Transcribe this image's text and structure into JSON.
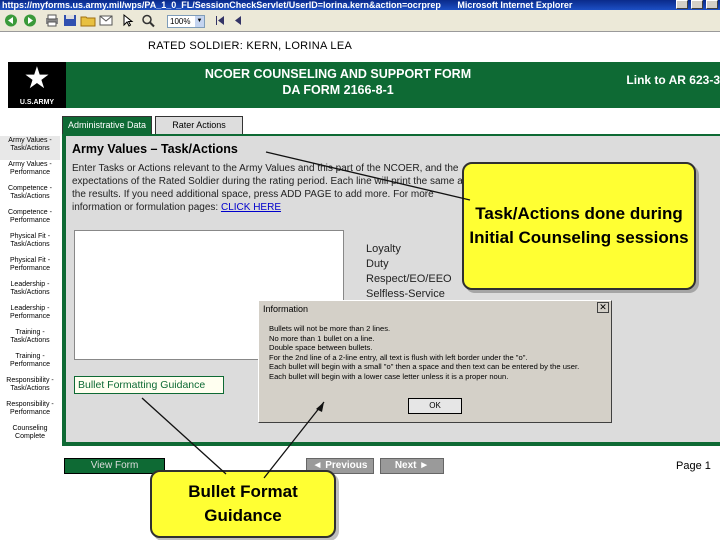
{
  "browser": {
    "url": "https://myforms.us.army.mil/wps/PA_1_0_FL/SessionCheckServlet/UserID=lorina.kern&action=ocrprep",
    "app_name": "Microsoft Internet Explorer",
    "zoom": "100%"
  },
  "rated_soldier": "RATED SOLDIER:  KERN, LORINA LEA",
  "header": {
    "logo_text": "U.S.ARMY",
    "form_title_line1": "NCOER COUNSELING AND SUPPORT FORM",
    "form_title_line2": "DA FORM 2166-8-1",
    "link_label": "Link to AR 623-3"
  },
  "tabs": [
    {
      "label": "Administrative Data"
    },
    {
      "label": "Rater Actions"
    }
  ],
  "sidebar": {
    "items": [
      {
        "line1": "Army Values -",
        "line2": "Task/Actions"
      },
      {
        "line1": "Army Values -",
        "line2": "Performance"
      },
      {
        "line1": "Competence -",
        "line2": "Task/Actions"
      },
      {
        "line1": "Competence -",
        "line2": "Performance"
      },
      {
        "line1": "Physical Fit -",
        "line2": "Task/Actions"
      },
      {
        "line1": "Physical Fit -",
        "line2": "Performance"
      },
      {
        "line1": "Leadership -",
        "line2": "Task/Actions"
      },
      {
        "line1": "Leadership -",
        "line2": "Performance"
      },
      {
        "line1": "Training -",
        "line2": "Task/Actions"
      },
      {
        "line1": "Training -",
        "line2": "Performance"
      },
      {
        "line1": "Responsibility -",
        "line2": "Task/Actions"
      },
      {
        "line1": "Responsibility -",
        "line2": "Performance"
      },
      {
        "line1": "Counseling",
        "line2": "Complete"
      }
    ]
  },
  "main": {
    "section_title": "Army Values – Task/Actions",
    "instructions": "Enter Tasks or Actions relevant to the Army Values and this part of the NCOER, and the expectations of the Rated Soldier during the rating period. Each line will print the same as the results. If you need additional space, press ADD PAGE to add more. For more information or formulation pages:",
    "click_here": "CLICK HERE",
    "values_list": [
      "Loyalty",
      "Duty",
      "Respect/EO/EEO",
      "Selfless-Service"
    ],
    "bullet_guidance_label": "Bullet Formatting Guidance"
  },
  "buttons": {
    "view_form": "View Form",
    "previous": "◄ Previous",
    "next": "Next ►",
    "page": "Page 1"
  },
  "dialog": {
    "title": "Information",
    "lines": [
      "Bullets will not be more than 2 lines.",
      "No more than 1 bullet on a line.",
      "Double space between bullets.",
      "For the 2nd line of a 2-line entry, all text is flush with left border under the \"o\".",
      "Each bullet will begin with a small \"o\" then a space and then text can be entered by the user.",
      "Each bullet will begin with a lower case letter unless it is a proper noun."
    ],
    "ok_label": "OK"
  },
  "callouts": {
    "task_actions": "Task/Actions done during Initial Counseling sessions",
    "bullet_format": "Bullet Format Guidance"
  },
  "colors": {
    "army_green": "#0e6a34",
    "callout_yellow": "#ffff33",
    "panel_gray": "#dcdcdc"
  }
}
